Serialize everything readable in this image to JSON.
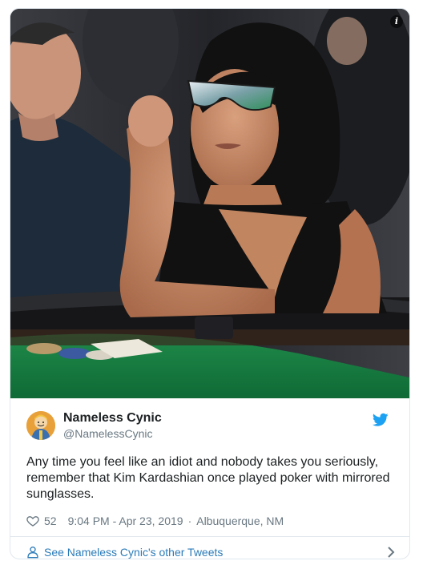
{
  "tweet": {
    "media_alt_icon": "info-icon",
    "author": {
      "name": "Nameless Cynic",
      "handle": "@NamelessCynic",
      "avatar_icon": "avatar-icon"
    },
    "platform_icon": "twitter-bird-icon",
    "text": "Any time you feel like an idiot and nobody takes you seriously, remember that Kim Kardashian once played poker with mirrored sunglasses.",
    "likes": "52",
    "timestamp": "9:04 PM - Apr 23, 2019",
    "separator": "·",
    "location": "Albuquerque, NM",
    "other_tweets_label": "See Nameless Cynic's other Tweets"
  },
  "colors": {
    "link": "#2b7bb9",
    "secondary_text": "#697882",
    "border": "#e1e8ed",
    "twitter_blue": "#1da1f2"
  }
}
